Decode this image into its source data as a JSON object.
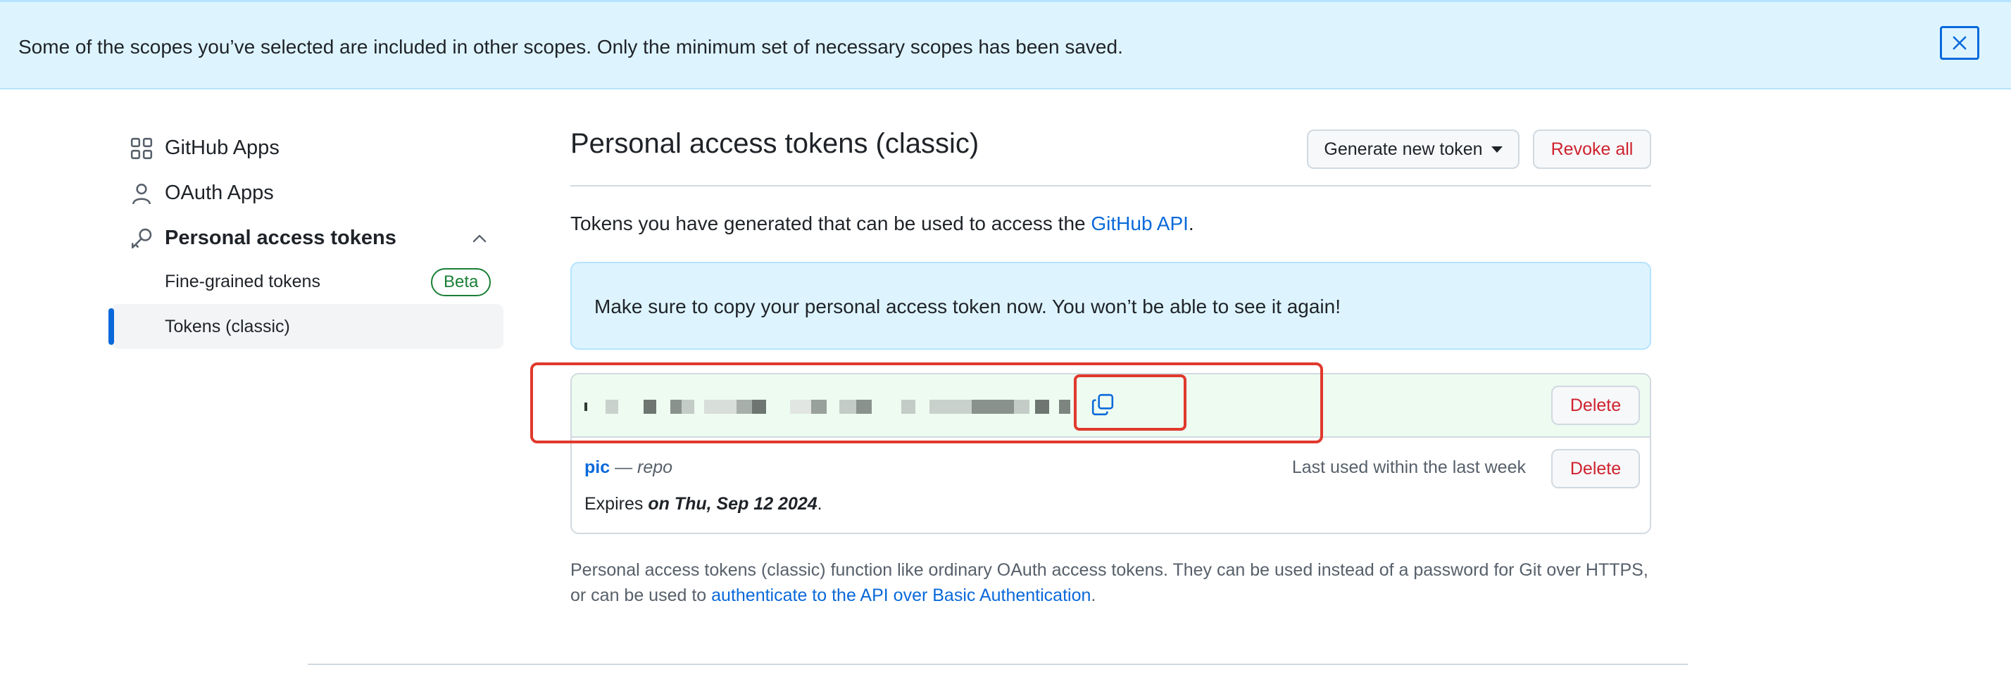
{
  "flash": {
    "message": "Some of the scopes you’ve selected are included in other scopes. Only the minimum set of necessary scopes has been saved.",
    "close_icon": "x-icon"
  },
  "sidebar": {
    "items": [
      {
        "label": "GitHub Apps",
        "icon": "apps-grid-icon"
      },
      {
        "label": "OAuth Apps",
        "icon": "person-icon"
      },
      {
        "label": "Personal access tokens",
        "icon": "key-icon",
        "expanded": true
      }
    ],
    "subitems": [
      {
        "label": "Fine-grained tokens",
        "badge": "Beta"
      },
      {
        "label": "Tokens (classic)",
        "active": true
      }
    ]
  },
  "main": {
    "title": "Personal access tokens (classic)",
    "generate_button": "Generate new token",
    "revoke_button": "Revoke all",
    "intro_prefix": "Tokens you have generated that can be used to access the ",
    "intro_link": "GitHub API",
    "intro_suffix": ".",
    "notice": "Make sure to copy your personal access token now. You won’t be able to see it again!"
  },
  "tokens": {
    "new_token": {
      "delete_label": "Delete",
      "copy_icon": "copy-icon"
    },
    "existing_token": {
      "name": "pic",
      "separator": " — ",
      "scope": "repo",
      "last_used": "Last used within the last week",
      "delete_label": "Delete",
      "expires_prefix": "Expires ",
      "expires_date": "on Thu, Sep 12 2024",
      "expires_suffix": "."
    }
  },
  "footnote": {
    "text": "Personal access tokens (classic) function like ordinary OAuth access tokens. They can be used instead of a password for Git over HTTPS, or can be used to ",
    "link": "authenticate to the API over Basic Authentication",
    "suffix": "."
  },
  "colors": {
    "accent": "#0969da",
    "danger": "#cf222e",
    "success": "#1a7f37",
    "flash_bg": "#ddf4ff",
    "annotation_red": "#e0392c"
  }
}
